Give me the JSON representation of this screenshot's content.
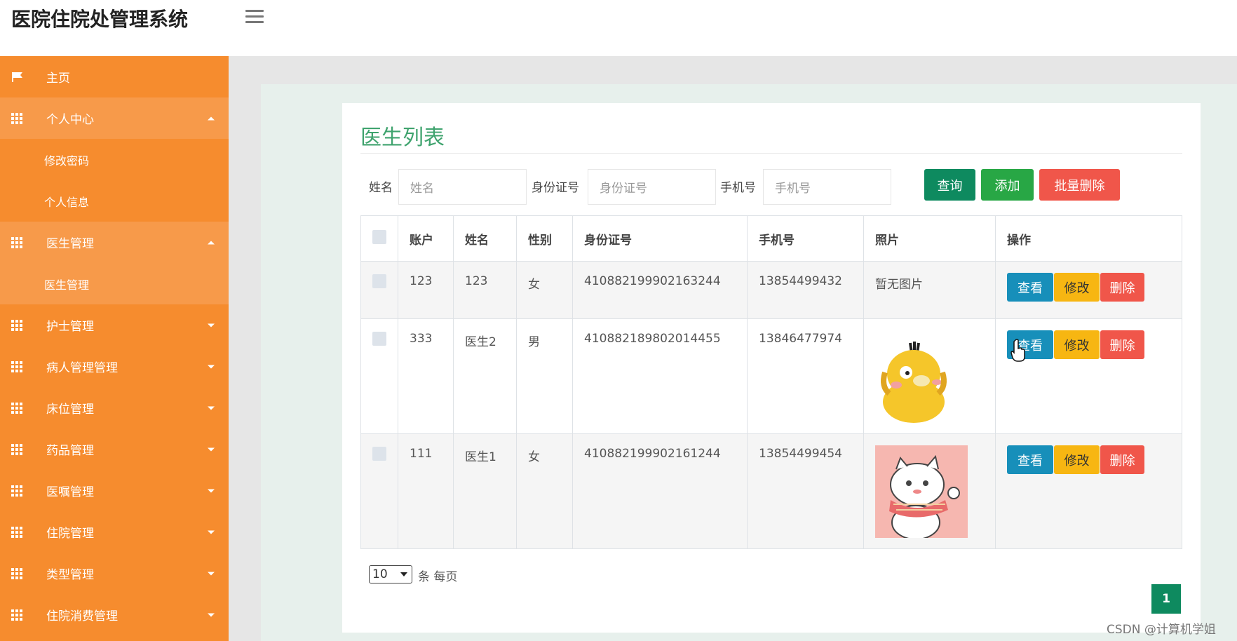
{
  "app": {
    "title": "医院住院处管理系统"
  },
  "sidebar": {
    "items": [
      {
        "label": "主页",
        "icon": "flag-icon"
      },
      {
        "label": "个人中心",
        "icon": "grid-icon",
        "expanded": true,
        "children": [
          "修改密码",
          "个人信息"
        ]
      },
      {
        "label": "医生管理",
        "icon": "grid-icon",
        "expanded": true,
        "children": [
          "医生管理"
        ]
      },
      {
        "label": "护士管理",
        "icon": "grid-icon"
      },
      {
        "label": "病人管理管理",
        "icon": "grid-icon"
      },
      {
        "label": "床位管理",
        "icon": "grid-icon"
      },
      {
        "label": "药品管理",
        "icon": "grid-icon"
      },
      {
        "label": "医嘱管理",
        "icon": "grid-icon"
      },
      {
        "label": "住院管理",
        "icon": "grid-icon"
      },
      {
        "label": "类型管理",
        "icon": "grid-icon"
      },
      {
        "label": "住院消费管理",
        "icon": "grid-icon"
      }
    ]
  },
  "main": {
    "title": "医生列表",
    "search": {
      "name_label": "姓名",
      "name_placeholder": "姓名",
      "id_label": "身份证号",
      "id_placeholder": "身份证号",
      "phone_label": "手机号",
      "phone_placeholder": "手机号",
      "query_btn": "查询",
      "add_btn": "添加",
      "batch_delete_btn": "批量删除"
    },
    "table": {
      "headers": [
        "账户",
        "姓名",
        "性别",
        "身份证号",
        "手机号",
        "照片",
        "操作"
      ],
      "rows": [
        {
          "account": "123",
          "name": "123",
          "gender": "女",
          "id_number": "410882199902163244",
          "phone": "13854499432",
          "photo": "暂无图片"
        },
        {
          "account": "333",
          "name": "医生2",
          "gender": "男",
          "id_number": "410882189802014455",
          "phone": "13846477974",
          "photo": "yellow-duck-sticker"
        },
        {
          "account": "111",
          "name": "医生1",
          "gender": "女",
          "id_number": "410882199902161244",
          "phone": "13854499454",
          "photo": "cat-with-scarf-sticker"
        }
      ],
      "actions": {
        "view": "查看",
        "edit": "修改",
        "delete": "删除"
      }
    },
    "pager": {
      "page_size": "10",
      "page_size_label": "条 每页",
      "current_page": "1"
    }
  },
  "watermark": "CSDN @计算机学姐",
  "colors": {
    "sidebar": "#f68c2e",
    "sidebar_open": "#f79a4a",
    "title_green": "#3fa36e",
    "query": "#0e8a5f",
    "add": "#28a745",
    "batch_delete": "#f0564a",
    "view": "#178fba",
    "edit": "#f7b612",
    "delete": "#f0564a"
  }
}
